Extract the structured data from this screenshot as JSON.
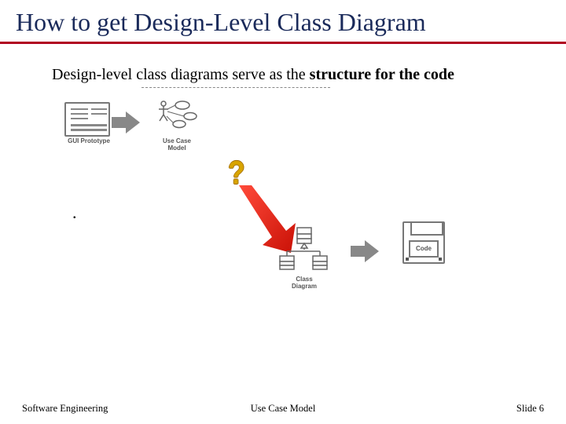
{
  "title": "How to get Design-Level Class Diagram",
  "lead_plain": "Design-level class diagrams serve as the ",
  "lead_bold": "structure for the code",
  "bullet_dot": ".",
  "labels": {
    "gui": "GUI Prototype",
    "usecase": "Use Case\nModel",
    "classdiag": "Class\nDiagram",
    "code": "Code"
  },
  "qmark": "?",
  "footer": {
    "left": "Software Engineering",
    "center": "Use Case Model",
    "right_prefix": "Slide ",
    "right_num": "6"
  }
}
